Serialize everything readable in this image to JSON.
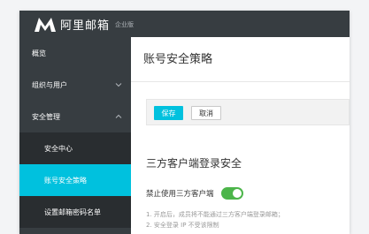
{
  "app": {
    "logo_text": "阿里邮箱",
    "logo_badge": "企业版"
  },
  "sidebar": {
    "items": [
      {
        "label": "概览"
      },
      {
        "label": "组织与用户"
      },
      {
        "label": "安全管理"
      },
      {
        "label": "安全中心"
      },
      {
        "label": "账号安全策略"
      },
      {
        "label": "设置邮箱密码名单"
      }
    ]
  },
  "main": {
    "title": "账号安全策略",
    "toolbar": {
      "save_label": "保存",
      "cancel_label": "取消"
    },
    "section_title": "三方客户端登录安全",
    "setting": {
      "label": "禁止使用三方客户端",
      "enabled": true
    },
    "notes": [
      "1. 开启后，成员将不能通过三方客户端登录邮箱；",
      "2. 安全登录 IP 不受该限制"
    ]
  },
  "colors": {
    "sidebar_bg": "#373d41",
    "active_bg": "#00c1de",
    "accent": "#00c1de",
    "toggle_on": "#4cb54a"
  }
}
